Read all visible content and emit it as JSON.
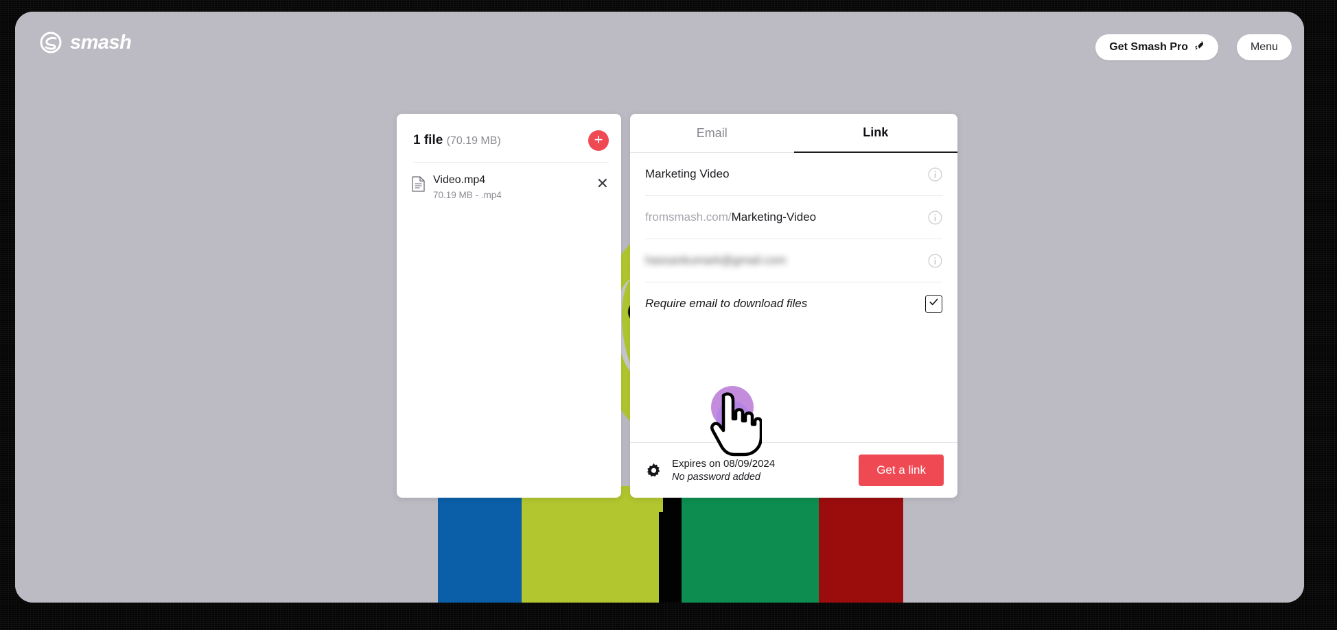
{
  "app": {
    "brand": "smash",
    "brand_icon": "smash-s-logo"
  },
  "topbar": {
    "pro_button": "Get Smash Pro",
    "pro_icon": "rocket-icon",
    "menu_button": "Menu"
  },
  "files_panel": {
    "count_label": "1 file",
    "total_size": "(70.19 MB)",
    "add_icon": "plus-icon",
    "remove_icon": "close-icon",
    "file_icon": "document-icon",
    "files": [
      {
        "name": "Video.mp4",
        "meta": "70.19 MB  -  .mp4"
      }
    ]
  },
  "share_panel": {
    "tabs": [
      {
        "label": "Email",
        "active": false
      },
      {
        "label": "Link",
        "active": true
      }
    ],
    "fields": {
      "title": {
        "value": "Marketing Video",
        "info_icon": "info-icon"
      },
      "link": {
        "prefix": "fromsmash.com/",
        "slug": "Marketing-Video",
        "info_icon": "info-icon"
      },
      "email": {
        "value": "hassankumark@gmail.com",
        "blurred": true,
        "info_icon": "info-icon"
      }
    },
    "require_email": {
      "label": "Require email to download files",
      "checked": true,
      "check_icon": "checkmark-icon"
    },
    "footer": {
      "settings_icon": "gear-icon",
      "expiry": "Expires on 08/09/2024",
      "password": "No password added",
      "submit_label": "Get a link"
    }
  },
  "cursor": {
    "icon": "pointing-hand-cursor",
    "click_indicator": "click-ripple"
  },
  "colors": {
    "accent_red": "#ef4a54",
    "page_bg": "#bcbac2",
    "band_blue": "#0a5fa8",
    "band_lime": "#b2c62f",
    "band_black": "#020202",
    "band_green": "#0d8d4f",
    "band_darkred": "#9b0c0d",
    "ripple_purple": "#a046c8"
  }
}
